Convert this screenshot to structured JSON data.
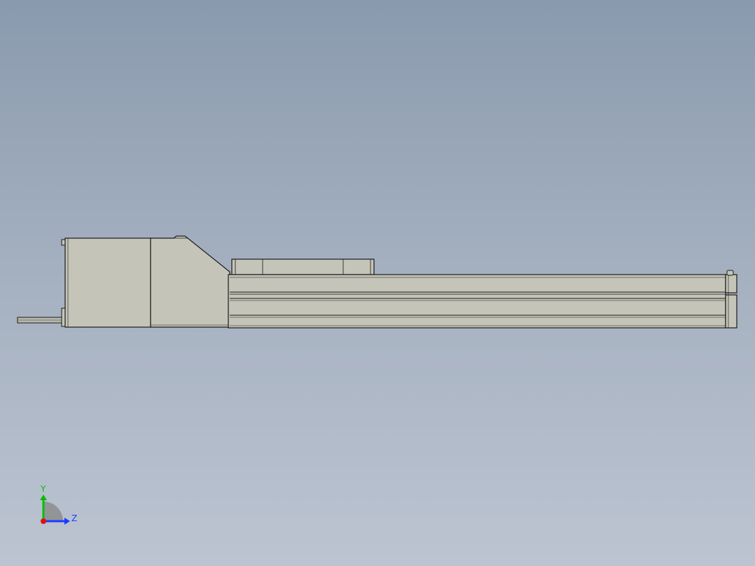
{
  "viewport": {
    "background_top": "#8a9aae",
    "background_bottom": "#bcc4d1"
  },
  "model": {
    "body_fill": "#c4c4b8",
    "edge_color": "#1a1a1a",
    "shaft_fill": "#b8b8b0"
  },
  "triad": {
    "y_label": "Y",
    "z_label": "Z",
    "y_color": "#00c000",
    "z_color": "#1a3cff",
    "x_color": "#e01010",
    "plane_color": "#8c8c8c"
  }
}
